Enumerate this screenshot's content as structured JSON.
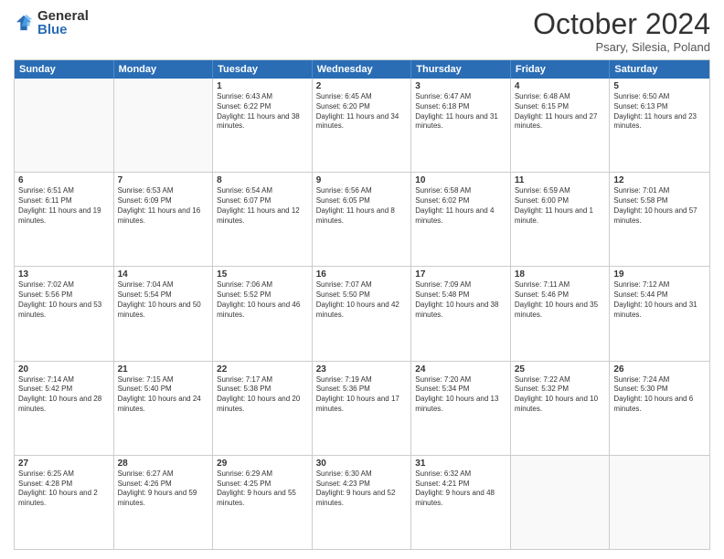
{
  "logo": {
    "general": "General",
    "blue": "Blue"
  },
  "header": {
    "month": "October 2024",
    "location": "Psary, Silesia, Poland"
  },
  "weekdays": [
    "Sunday",
    "Monday",
    "Tuesday",
    "Wednesday",
    "Thursday",
    "Friday",
    "Saturday"
  ],
  "rows": [
    [
      {
        "day": "",
        "text": "",
        "empty": true
      },
      {
        "day": "",
        "text": "",
        "empty": true
      },
      {
        "day": "1",
        "text": "Sunrise: 6:43 AM\nSunset: 6:22 PM\nDaylight: 11 hours and 38 minutes."
      },
      {
        "day": "2",
        "text": "Sunrise: 6:45 AM\nSunset: 6:20 PM\nDaylight: 11 hours and 34 minutes."
      },
      {
        "day": "3",
        "text": "Sunrise: 6:47 AM\nSunset: 6:18 PM\nDaylight: 11 hours and 31 minutes."
      },
      {
        "day": "4",
        "text": "Sunrise: 6:48 AM\nSunset: 6:15 PM\nDaylight: 11 hours and 27 minutes."
      },
      {
        "day": "5",
        "text": "Sunrise: 6:50 AM\nSunset: 6:13 PM\nDaylight: 11 hours and 23 minutes."
      }
    ],
    [
      {
        "day": "6",
        "text": "Sunrise: 6:51 AM\nSunset: 6:11 PM\nDaylight: 11 hours and 19 minutes."
      },
      {
        "day": "7",
        "text": "Sunrise: 6:53 AM\nSunset: 6:09 PM\nDaylight: 11 hours and 16 minutes."
      },
      {
        "day": "8",
        "text": "Sunrise: 6:54 AM\nSunset: 6:07 PM\nDaylight: 11 hours and 12 minutes."
      },
      {
        "day": "9",
        "text": "Sunrise: 6:56 AM\nSunset: 6:05 PM\nDaylight: 11 hours and 8 minutes."
      },
      {
        "day": "10",
        "text": "Sunrise: 6:58 AM\nSunset: 6:02 PM\nDaylight: 11 hours and 4 minutes."
      },
      {
        "day": "11",
        "text": "Sunrise: 6:59 AM\nSunset: 6:00 PM\nDaylight: 11 hours and 1 minute."
      },
      {
        "day": "12",
        "text": "Sunrise: 7:01 AM\nSunset: 5:58 PM\nDaylight: 10 hours and 57 minutes."
      }
    ],
    [
      {
        "day": "13",
        "text": "Sunrise: 7:02 AM\nSunset: 5:56 PM\nDaylight: 10 hours and 53 minutes."
      },
      {
        "day": "14",
        "text": "Sunrise: 7:04 AM\nSunset: 5:54 PM\nDaylight: 10 hours and 50 minutes."
      },
      {
        "day": "15",
        "text": "Sunrise: 7:06 AM\nSunset: 5:52 PM\nDaylight: 10 hours and 46 minutes."
      },
      {
        "day": "16",
        "text": "Sunrise: 7:07 AM\nSunset: 5:50 PM\nDaylight: 10 hours and 42 minutes."
      },
      {
        "day": "17",
        "text": "Sunrise: 7:09 AM\nSunset: 5:48 PM\nDaylight: 10 hours and 38 minutes."
      },
      {
        "day": "18",
        "text": "Sunrise: 7:11 AM\nSunset: 5:46 PM\nDaylight: 10 hours and 35 minutes."
      },
      {
        "day": "19",
        "text": "Sunrise: 7:12 AM\nSunset: 5:44 PM\nDaylight: 10 hours and 31 minutes."
      }
    ],
    [
      {
        "day": "20",
        "text": "Sunrise: 7:14 AM\nSunset: 5:42 PM\nDaylight: 10 hours and 28 minutes."
      },
      {
        "day": "21",
        "text": "Sunrise: 7:15 AM\nSunset: 5:40 PM\nDaylight: 10 hours and 24 minutes."
      },
      {
        "day": "22",
        "text": "Sunrise: 7:17 AM\nSunset: 5:38 PM\nDaylight: 10 hours and 20 minutes."
      },
      {
        "day": "23",
        "text": "Sunrise: 7:19 AM\nSunset: 5:36 PM\nDaylight: 10 hours and 17 minutes."
      },
      {
        "day": "24",
        "text": "Sunrise: 7:20 AM\nSunset: 5:34 PM\nDaylight: 10 hours and 13 minutes."
      },
      {
        "day": "25",
        "text": "Sunrise: 7:22 AM\nSunset: 5:32 PM\nDaylight: 10 hours and 10 minutes."
      },
      {
        "day": "26",
        "text": "Sunrise: 7:24 AM\nSunset: 5:30 PM\nDaylight: 10 hours and 6 minutes."
      }
    ],
    [
      {
        "day": "27",
        "text": "Sunrise: 6:25 AM\nSunset: 4:28 PM\nDaylight: 10 hours and 2 minutes."
      },
      {
        "day": "28",
        "text": "Sunrise: 6:27 AM\nSunset: 4:26 PM\nDaylight: 9 hours and 59 minutes."
      },
      {
        "day": "29",
        "text": "Sunrise: 6:29 AM\nSunset: 4:25 PM\nDaylight: 9 hours and 55 minutes."
      },
      {
        "day": "30",
        "text": "Sunrise: 6:30 AM\nSunset: 4:23 PM\nDaylight: 9 hours and 52 minutes."
      },
      {
        "day": "31",
        "text": "Sunrise: 6:32 AM\nSunset: 4:21 PM\nDaylight: 9 hours and 48 minutes."
      },
      {
        "day": "",
        "text": "",
        "empty": true
      },
      {
        "day": "",
        "text": "",
        "empty": true
      }
    ]
  ]
}
